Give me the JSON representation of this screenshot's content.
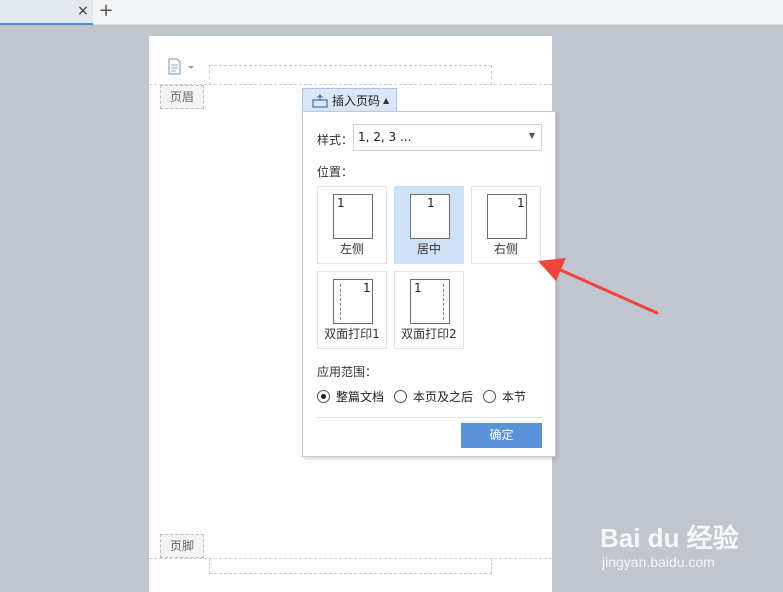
{
  "tabbar": {
    "close_glyph": "×",
    "add_glyph": "+"
  },
  "page": {
    "header_label": "页眉",
    "footer_label": "页脚"
  },
  "insert_button": {
    "label": "插入页码",
    "icon": "page-number-icon"
  },
  "popup": {
    "style_label": "样式：",
    "style_value": "1, 2, 3 ...",
    "position_label": "位置：",
    "position_options": [
      {
        "label": "左侧",
        "number": "1",
        "selected": false
      },
      {
        "label": "居中",
        "number": "1",
        "selected": true
      },
      {
        "label": "右侧",
        "number": "1",
        "selected": false
      },
      {
        "label": "双面打印1",
        "number": "1",
        "selected": false
      },
      {
        "label": "双面打印2",
        "number": "1",
        "selected": false
      }
    ],
    "scope_label": "应用范围：",
    "scope_options": [
      {
        "label": "整篇文档",
        "checked": true
      },
      {
        "label": "本页及之后",
        "checked": false
      },
      {
        "label": "本节",
        "checked": false
      }
    ],
    "ok_label": "确定"
  },
  "annotation": {
    "color": "#f0443a"
  },
  "watermark": {
    "main": "Bai du 经验",
    "url": "jingyan.baidu.com"
  },
  "colors": {
    "accent": "#5b93db",
    "selected_bg": "#cfe0f7",
    "background": "#c1c5ce"
  }
}
